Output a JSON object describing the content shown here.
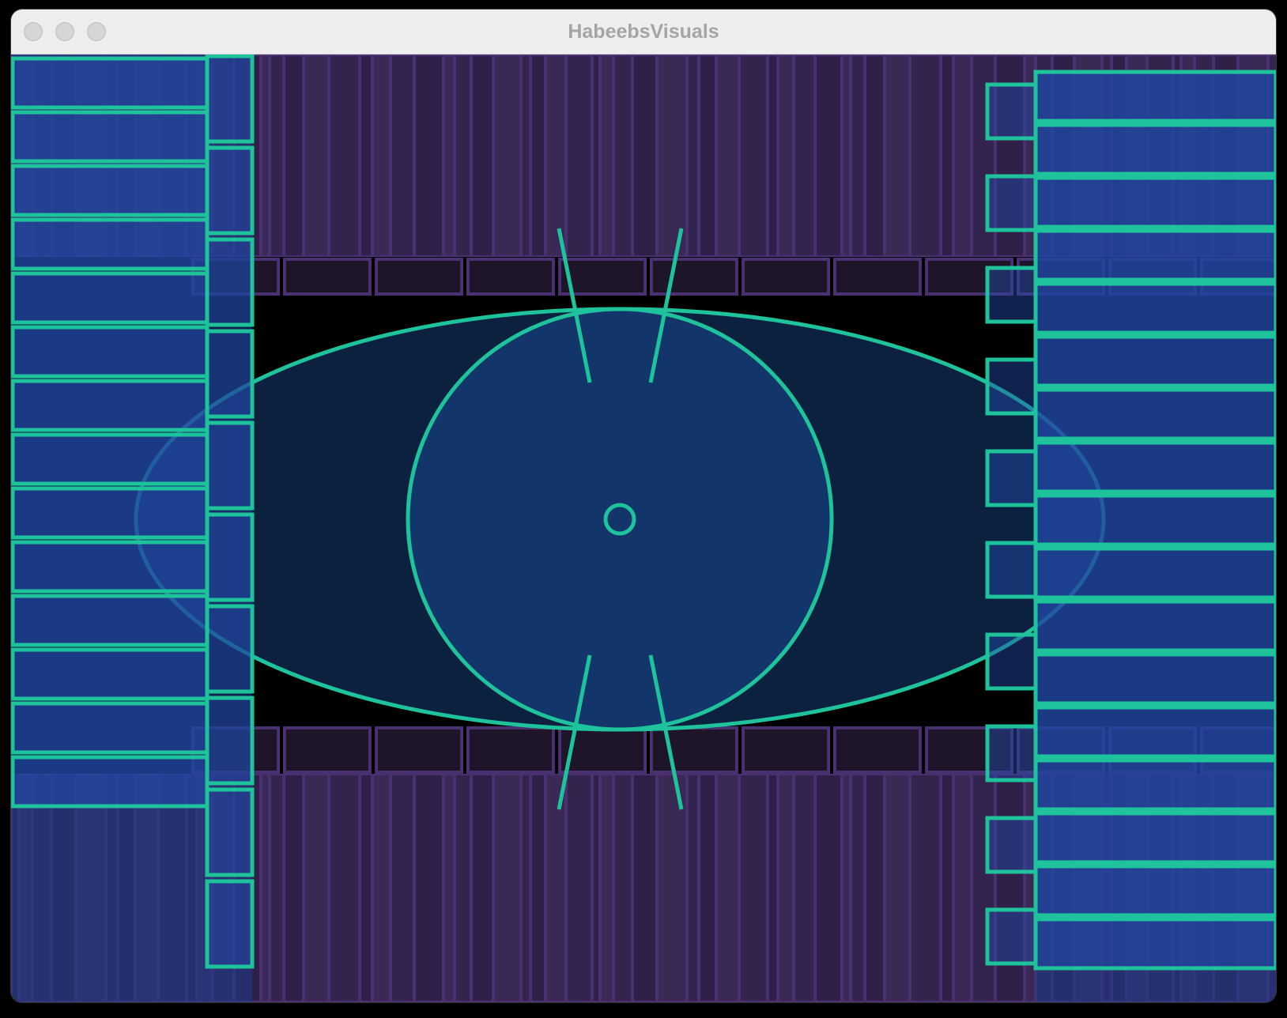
{
  "window": {
    "title": "HabeebsVisuals",
    "controls": [
      "close-button",
      "minimize-button",
      "zoom-button"
    ]
  },
  "visual": {
    "accent": "#1ec39b",
    "background": "#000000",
    "eye_fill": "#0c2140",
    "iris_fill": "#12356a",
    "bar_fill": "#3a2855",
    "bar_stroke": "#4a3070",
    "box_fill": "#1f3a80",
    "slot_fill": "#1e1628"
  }
}
